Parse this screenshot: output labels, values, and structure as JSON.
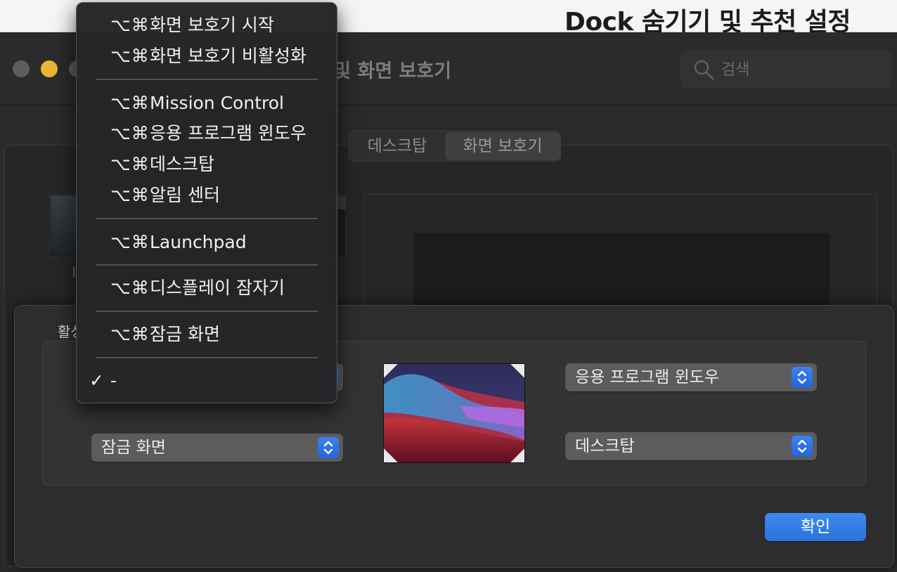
{
  "caption": "Dock 숨기기 및 추천 설정",
  "window": {
    "title": "탑 및 화면 보호기",
    "search_placeholder": "검색"
  },
  "tabs": [
    {
      "label": "데스크탑",
      "selected": false
    },
    {
      "label": "화면 보호기",
      "selected": true
    }
  ],
  "sheet": {
    "section_label": "활성",
    "corners": {
      "top_left": "-",
      "bottom_left": "잠금 화면",
      "top_right": "응용 프로그램 윈도우",
      "bottom_right": "데스크탑"
    },
    "ok_label": "확인"
  },
  "menu": {
    "modifier": "⌥⌘",
    "items": [
      {
        "label": "화면 보호기 시작"
      },
      {
        "label": "화면 보호기 비활성화"
      },
      {
        "label": "Mission Control"
      },
      {
        "label": "응용 프로그램 윈도우"
      },
      {
        "label": "데스크탑"
      },
      {
        "label": "알림 센터"
      },
      {
        "label": "Launchpad"
      },
      {
        "label": "디스플레이 잠자기"
      },
      {
        "label": "잠금 화면"
      }
    ],
    "selected_item": {
      "label": "-",
      "checked": true
    }
  },
  "colors": {
    "accent": "#2f74e0",
    "minimize_light": "#ecb435"
  }
}
